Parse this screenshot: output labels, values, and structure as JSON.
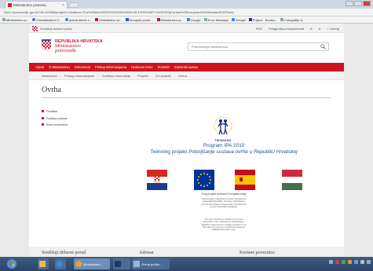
{
  "browser": {
    "tab_title": "Ministarstvo pravosu...",
    "tab_close": "×",
    "url_scheme": "https://",
    "url_rest": "pravosudje.gov.hr/?id=10188&pregled=1&datum=Thu%20Mar%2022%202018%2009:28:13%20GMT+0100%20(Central%20European%20Standard%20Time)",
    "bookmarks": [
      "Ministarstvo pr...",
      "Globaleksterni C...",
      "global admin n...",
      "Ministarstvo pr...",
      "Europski portal ...",
      "Ministarstvo pr...",
      "Google",
      "Error Message",
      "Google",
      "Prijava · Booker...",
      "Fotografije st"
    ]
  },
  "site": {
    "gov_link": "Središnji državni portal",
    "util_links": [
      "RSS",
      "Prilagodba pristupačnosti",
      "A",
      "A",
      "+ Uvećaj"
    ],
    "logo_line1": "REPUBLIKA HRVATSKA",
    "logo_line2": "Ministarstvo",
    "logo_line3": "pravosuđa",
    "search_placeholder": "Pretraživanje Ministarstva",
    "main_nav": [
      "Vijesti",
      "O Ministarstvu",
      "Dokumenti",
      "Pristup informacijama",
      "Istaknute teme",
      "Kontakti",
      "Zatvorski sustav"
    ],
    "breadcrumb": [
      "Naslovnica",
      "Pristup informacijama",
      "Godišnje informacije",
      "Projekti",
      "EU projekti",
      "Ovrha"
    ],
    "page_title": "Ovrha",
    "side_menu": [
      "Građani",
      "Sudska praksa",
      "Brze poveznice"
    ]
  },
  "content": {
    "twinning_label": "TWINNING",
    "line1": "Program IPA 2010",
    "line2_prefix": "Twinning projekt ",
    "line2_italic": "Poboljšanje sustava ovrhe u Republici Hrvatskoj",
    "eu_caption": "Ovaj projekt financira Europska unija",
    "small_text_1": "Ovaj program zajednički provode Ministarstvo pravosuđa Republike Hrvatske, Ministarstvo pravosuđa Kraljevine Španjolske i Ministarstvo pravde Republike Mađarske",
    "small_text_2": "Ova web stranica je izrađena uz pomoć Europske unije. Sadržaj ove publikacije je isključiva odgovornost nositelja projekta i ni na koji način ne može se smatrati da odražava stajališta Europske unije."
  },
  "footer": {
    "col1": "Središnji državni portal",
    "col2": "Adresar",
    "col3": "Korisne poveznice"
  },
  "taskbar": {
    "app1": "Ministarstvo...",
    "app2": "Untitled - Paint",
    "app3": "Ovrha profila..."
  },
  "colors": {
    "brand_red": "#d0121b",
    "twinning_blue": "#1c4fa3"
  }
}
